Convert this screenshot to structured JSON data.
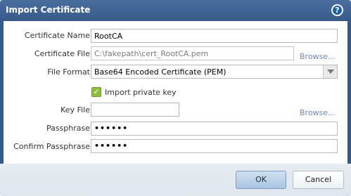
{
  "dialog": {
    "title": "Import Certificate",
    "help_icon": "question-circle-icon"
  },
  "form": {
    "certificate_name": {
      "label": "Certificate Name",
      "value": "RootCA"
    },
    "certificate_file": {
      "label": "Certificate File",
      "value": "C:\\fakepath\\cert_RootCA.pem",
      "browse_label": "Browse..."
    },
    "file_format": {
      "label": "File Format",
      "value": "Base64 Encoded Certificate (PEM)"
    },
    "import_private_key": {
      "label": "Import private key",
      "checked": true
    },
    "key_file": {
      "label": "Key File",
      "value": "",
      "browse_label": "Browse..."
    },
    "passphrase": {
      "label": "Passphrase",
      "value": "••••••"
    },
    "confirm_passphrase": {
      "label": "Confirm Passphrase",
      "value": "••••••"
    }
  },
  "buttons": {
    "ok": "OK",
    "cancel": "Cancel"
  },
  "colors": {
    "title_bar": "#365a88",
    "checkbox": "#8fbf3a",
    "link": "#6a88b7"
  }
}
